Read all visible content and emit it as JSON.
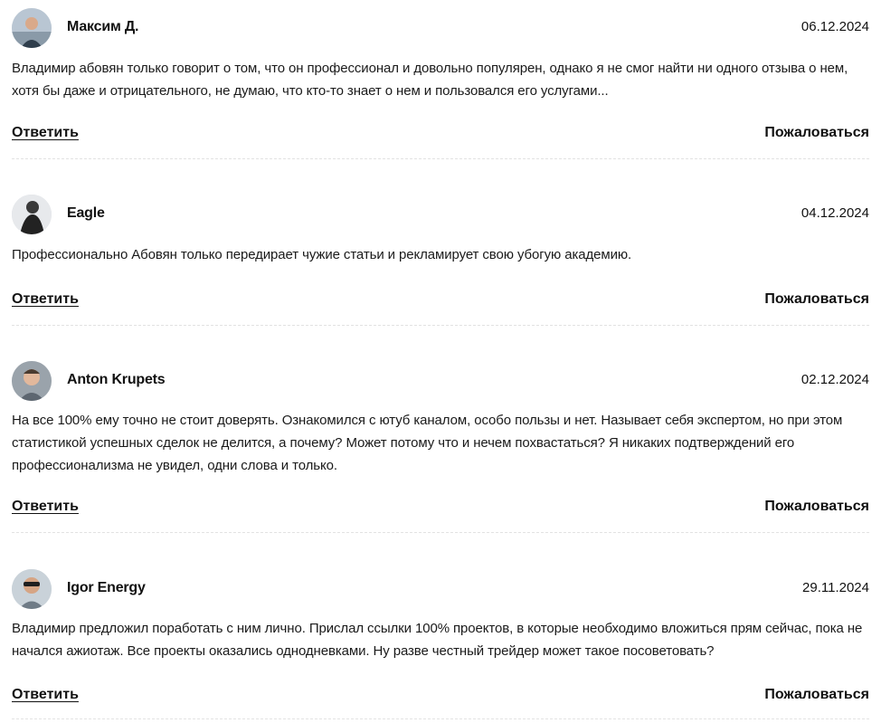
{
  "comments": [
    {
      "author": "Максим Д.",
      "date": "06.12.2024",
      "avatar_icon": "avatar-photo-icon",
      "text": "Владимир абовян только говорит о том, что он профессионал и довольно популярен, однако я не смог найти ни одного отзыва о нем, хотя бы даже и отрицательного, не думаю, что кто-то знает о нем и пользовался его услугами...",
      "reply_label": "Ответить",
      "report_label": "Пожаловаться"
    },
    {
      "author": "Eagle",
      "date": "04.12.2024",
      "avatar_icon": "avatar-photo-icon",
      "text": "Профессионально Абовян только передирает чужие статьи и рекламирует свою убогую академию.",
      "reply_label": "Ответить",
      "report_label": "Пожаловаться"
    },
    {
      "author": "Anton Krupets",
      "date": "02.12.2024",
      "avatar_icon": "avatar-photo-icon",
      "text": "На все 100% ему точно не стоит доверять. Ознакомился с ютуб каналом, особо пользы и нет. Называет себя экспертом, но при этом статистикой успешных сделок не делится, а почему? Может потому что и нечем похвастаться? Я никаких подтверждений его профессионализма не увидел, одни слова и только.",
      "reply_label": "Ответить",
      "report_label": "Пожаловаться"
    },
    {
      "author": "Igor Energy",
      "date": "29.11.2024",
      "avatar_icon": "avatar-photo-icon",
      "text": "Владимир предложил поработать с ним лично. Прислал ссылки 100% проектов, в которые необходимо вложиться прям сейчас, пока не начался ажиотаж. Все проекты оказались однодневками. Ну разве честный трейдер может такое посоветовать?",
      "reply_label": "Ответить",
      "report_label": "Пожаловаться"
    }
  ]
}
